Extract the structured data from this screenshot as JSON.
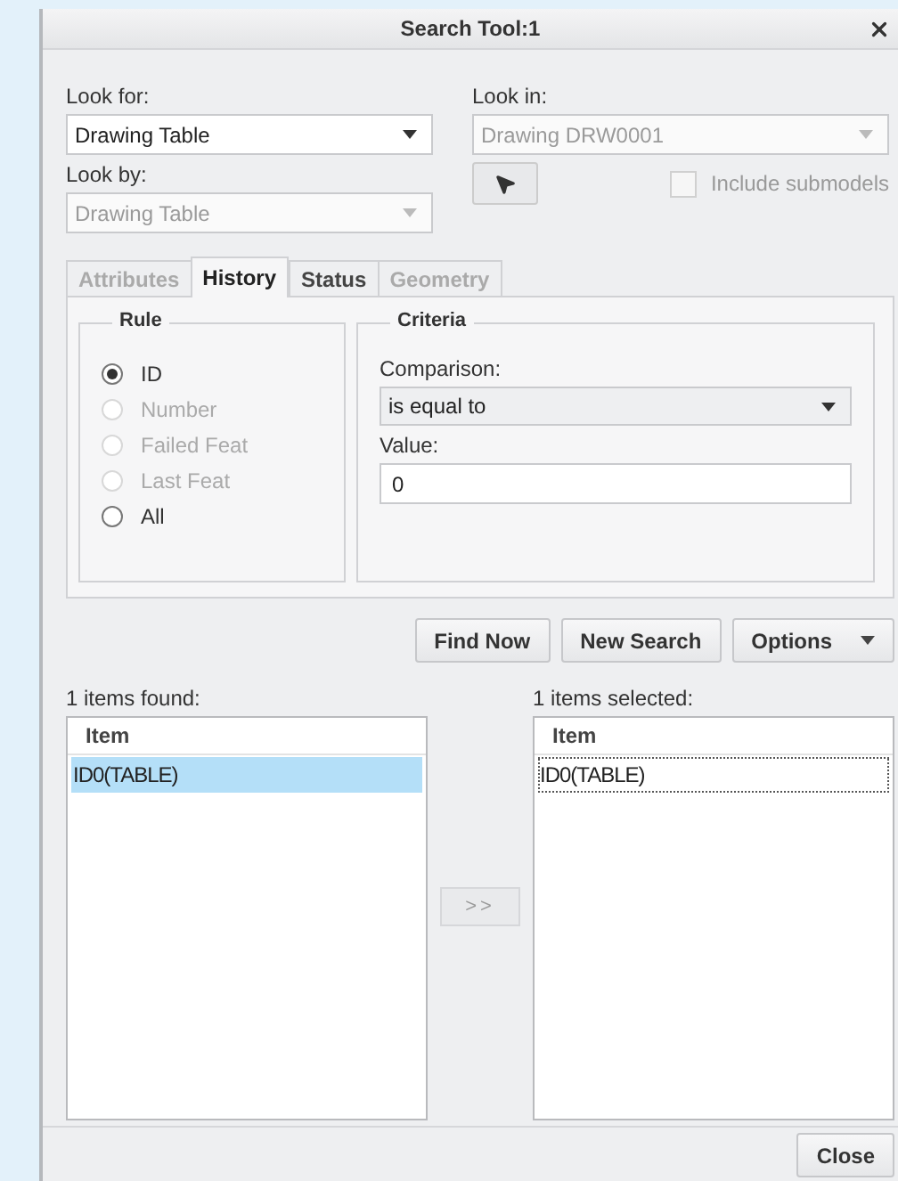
{
  "window": {
    "title": "Search Tool:1"
  },
  "look_for": {
    "label": "Look for:",
    "value": "Drawing Table",
    "disabled": false
  },
  "look_by": {
    "label": "Look by:",
    "value": "Drawing Table",
    "disabled": true
  },
  "look_in": {
    "label": "Look in:",
    "value": "Drawing DRW0001",
    "disabled": true
  },
  "include_submodels": {
    "label": "Include submodels",
    "checked": false,
    "disabled": true
  },
  "tabs": [
    {
      "label": "Attributes",
      "selected": false,
      "disabled": true
    },
    {
      "label": "History",
      "selected": true,
      "disabled": false
    },
    {
      "label": "Status",
      "selected": false,
      "disabled": false
    },
    {
      "label": "Geometry",
      "selected": false,
      "disabled": true
    }
  ],
  "rule": {
    "title": "Rule",
    "options": [
      {
        "label": "ID",
        "selected": true,
        "disabled": false
      },
      {
        "label": "Number",
        "selected": false,
        "disabled": true
      },
      {
        "label": "Failed Feat",
        "selected": false,
        "disabled": true
      },
      {
        "label": "Last Feat",
        "selected": false,
        "disabled": true
      },
      {
        "label": "All",
        "selected": false,
        "disabled": false
      }
    ]
  },
  "criteria": {
    "title": "Criteria",
    "comparison_label": "Comparison:",
    "comparison": "is equal to",
    "value_label": "Value:",
    "value": "0"
  },
  "actions": [
    {
      "label": "Find Now",
      "kind": "plain"
    },
    {
      "label": "New Search",
      "kind": "plain"
    },
    {
      "label": "Options",
      "kind": "menu"
    }
  ],
  "found": {
    "label": "1 items found:",
    "column": "Item",
    "rows": [
      {
        "text": "ID0(TABLE)",
        "selected": true
      }
    ]
  },
  "transfer": ">>",
  "chosen": {
    "label": "1 items selected:",
    "column": "Item",
    "rows": [
      {
        "text": "ID0(TABLE)",
        "focused": true
      }
    ]
  },
  "close": "Close"
}
